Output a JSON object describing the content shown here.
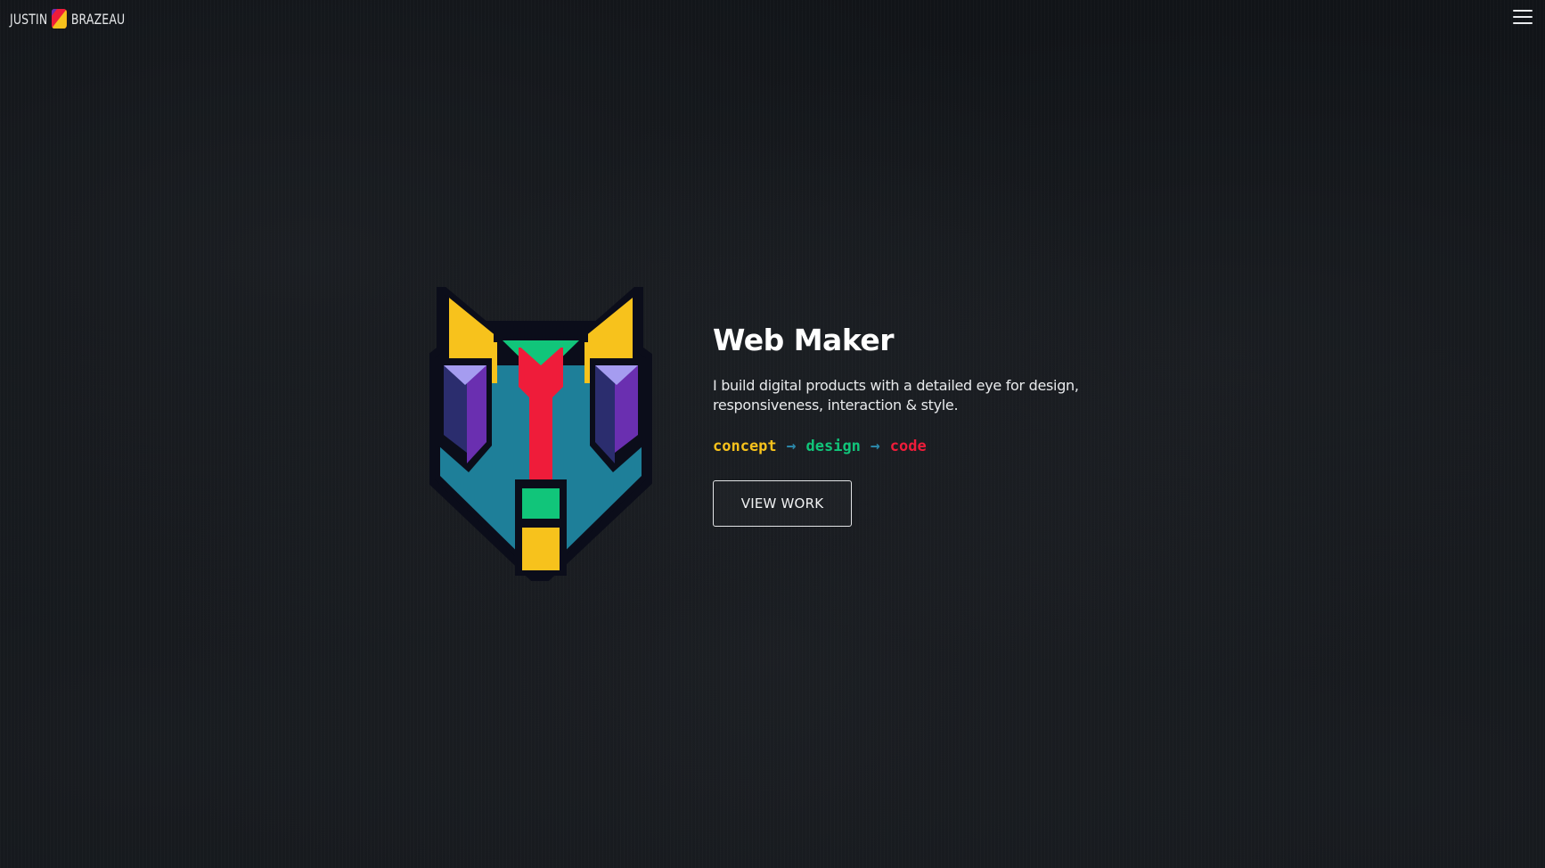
{
  "header": {
    "brand_first": "JUSTIN",
    "brand_last": "BRAZEAU",
    "brand_icon": "brand-logo-mark",
    "menu_icon": "hamburger-menu-icon"
  },
  "hero": {
    "title": "Web Maker",
    "description": "I build digital products with a detailed eye for design, responsiveness, interaction & style.",
    "pipeline": {
      "concept": "concept",
      "design": "design",
      "code": "code",
      "arrow": "→"
    },
    "cta_label": "VIEW WORK"
  },
  "colors": {
    "background": "#111418",
    "yellow": "#f7c21c",
    "green": "#11c57a",
    "red": "#ef1c3a",
    "teal": "#1e7f99",
    "purple": "#6a2fb0",
    "navy": "#2b2d6e",
    "lavender": "#a59cf0"
  }
}
